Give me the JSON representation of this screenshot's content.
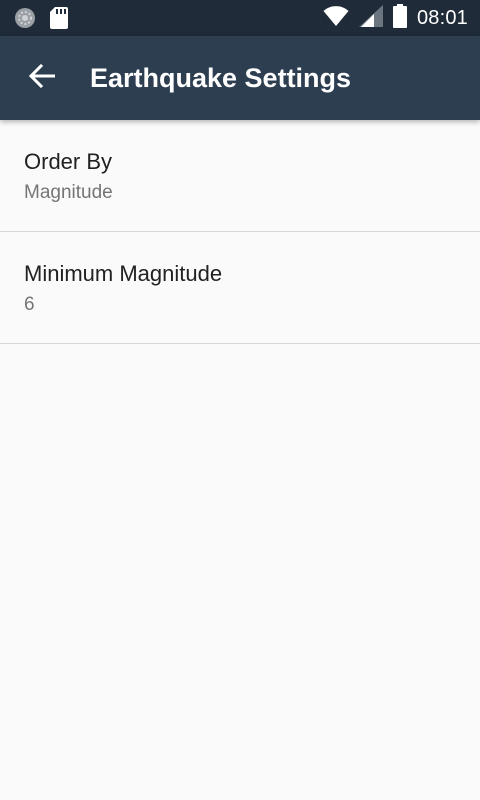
{
  "status_bar": {
    "time": "08:01",
    "icons": [
      "sync-icon",
      "sd-card-icon",
      "wifi-icon",
      "signal-icon",
      "battery-icon"
    ]
  },
  "toolbar": {
    "back_icon": "arrow-back-icon",
    "title": "Earthquake Settings"
  },
  "settings": [
    {
      "title": "Order By",
      "summary": "Magnitude"
    },
    {
      "title": "Minimum Magnitude",
      "summary": "6"
    }
  ],
  "colors": {
    "status_bar": "#1f2b38",
    "toolbar": "#2c3e50",
    "background": "#fafafa",
    "title_text": "#212121",
    "summary_text": "#757575",
    "divider": "#d6d6d6"
  }
}
